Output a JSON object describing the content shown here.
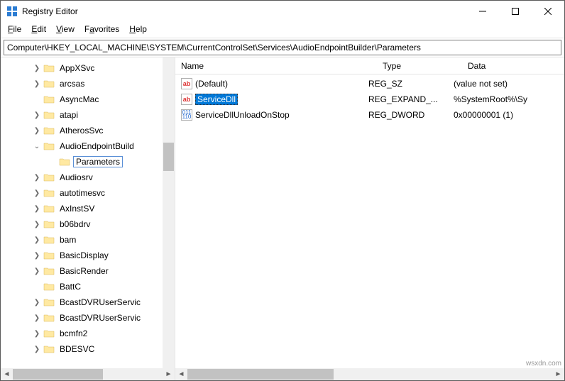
{
  "window": {
    "title": "Registry Editor"
  },
  "menu": {
    "file": "File",
    "edit": "Edit",
    "view": "View",
    "favorites": "Favorites",
    "help": "Help"
  },
  "address": "Computer\\HKEY_LOCAL_MACHINE\\SYSTEM\\CurrentControlSet\\Services\\AudioEndpointBuilder\\Parameters",
  "tree": [
    {
      "label": "AppXSvc",
      "expander": ">",
      "indent": 44
    },
    {
      "label": "arcsas",
      "expander": ">",
      "indent": 44
    },
    {
      "label": "AsyncMac",
      "expander": "",
      "indent": 44
    },
    {
      "label": "atapi",
      "expander": ">",
      "indent": 44
    },
    {
      "label": "AtherosSvc",
      "expander": ">",
      "indent": 44
    },
    {
      "label": "AudioEndpointBuild",
      "expander": "v",
      "indent": 44,
      "expanded": true
    },
    {
      "label": "Parameters",
      "expander": "",
      "indent": 66,
      "selected": true
    },
    {
      "label": "Audiosrv",
      "expander": ">",
      "indent": 44
    },
    {
      "label": "autotimesvc",
      "expander": ">",
      "indent": 44
    },
    {
      "label": "AxInstSV",
      "expander": ">",
      "indent": 44
    },
    {
      "label": "b06bdrv",
      "expander": ">",
      "indent": 44
    },
    {
      "label": "bam",
      "expander": ">",
      "indent": 44
    },
    {
      "label": "BasicDisplay",
      "expander": ">",
      "indent": 44
    },
    {
      "label": "BasicRender",
      "expander": ">",
      "indent": 44
    },
    {
      "label": "BattC",
      "expander": "",
      "indent": 44
    },
    {
      "label": "BcastDVRUserServic",
      "expander": ">",
      "indent": 44
    },
    {
      "label": "BcastDVRUserServic",
      "expander": ">",
      "indent": 44
    },
    {
      "label": "bcmfn2",
      "expander": ">",
      "indent": 44
    },
    {
      "label": "BDESVC",
      "expander": ">",
      "indent": 44
    }
  ],
  "columns": {
    "name": "Name",
    "type": "Type",
    "data": "Data"
  },
  "values": [
    {
      "icon": "str",
      "name": "(Default)",
      "type": "REG_SZ",
      "data": "(value not set)",
      "selected": false
    },
    {
      "icon": "str",
      "name": "ServiceDll",
      "type": "REG_EXPAND_...",
      "data": "%SystemRoot%\\Sy",
      "selected": true
    },
    {
      "icon": "bin",
      "name": "ServiceDllUnloadOnStop",
      "type": "REG_DWORD",
      "data": "0x00000001 (1)",
      "selected": false
    }
  ],
  "watermark": "wsxdn.com"
}
